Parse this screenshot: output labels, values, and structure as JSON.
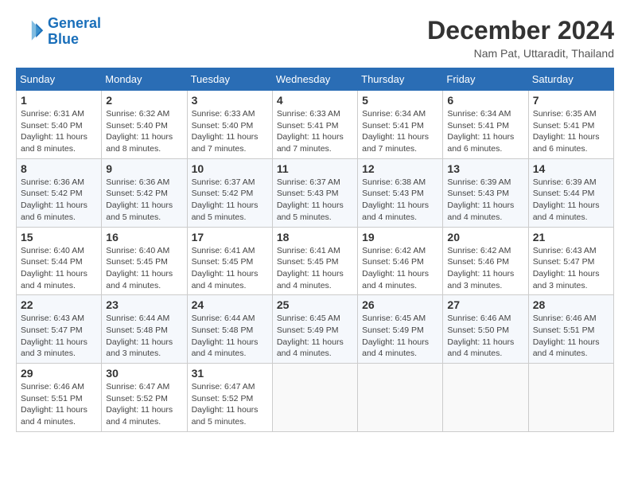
{
  "header": {
    "logo_line1": "General",
    "logo_line2": "Blue",
    "month_title": "December 2024",
    "location": "Nam Pat, Uttaradit, Thailand"
  },
  "days_of_week": [
    "Sunday",
    "Monday",
    "Tuesday",
    "Wednesday",
    "Thursday",
    "Friday",
    "Saturday"
  ],
  "weeks": [
    [
      {
        "day": "1",
        "sunrise": "6:31 AM",
        "sunset": "5:40 PM",
        "daylight": "11 hours and 8 minutes."
      },
      {
        "day": "2",
        "sunrise": "6:32 AM",
        "sunset": "5:40 PM",
        "daylight": "11 hours and 8 minutes."
      },
      {
        "day": "3",
        "sunrise": "6:33 AM",
        "sunset": "5:40 PM",
        "daylight": "11 hours and 7 minutes."
      },
      {
        "day": "4",
        "sunrise": "6:33 AM",
        "sunset": "5:41 PM",
        "daylight": "11 hours and 7 minutes."
      },
      {
        "day": "5",
        "sunrise": "6:34 AM",
        "sunset": "5:41 PM",
        "daylight": "11 hours and 7 minutes."
      },
      {
        "day": "6",
        "sunrise": "6:34 AM",
        "sunset": "5:41 PM",
        "daylight": "11 hours and 6 minutes."
      },
      {
        "day": "7",
        "sunrise": "6:35 AM",
        "sunset": "5:41 PM",
        "daylight": "11 hours and 6 minutes."
      }
    ],
    [
      {
        "day": "8",
        "sunrise": "6:36 AM",
        "sunset": "5:42 PM",
        "daylight": "11 hours and 6 minutes."
      },
      {
        "day": "9",
        "sunrise": "6:36 AM",
        "sunset": "5:42 PM",
        "daylight": "11 hours and 5 minutes."
      },
      {
        "day": "10",
        "sunrise": "6:37 AM",
        "sunset": "5:42 PM",
        "daylight": "11 hours and 5 minutes."
      },
      {
        "day": "11",
        "sunrise": "6:37 AM",
        "sunset": "5:43 PM",
        "daylight": "11 hours and 5 minutes."
      },
      {
        "day": "12",
        "sunrise": "6:38 AM",
        "sunset": "5:43 PM",
        "daylight": "11 hours and 4 minutes."
      },
      {
        "day": "13",
        "sunrise": "6:39 AM",
        "sunset": "5:43 PM",
        "daylight": "11 hours and 4 minutes."
      },
      {
        "day": "14",
        "sunrise": "6:39 AM",
        "sunset": "5:44 PM",
        "daylight": "11 hours and 4 minutes."
      }
    ],
    [
      {
        "day": "15",
        "sunrise": "6:40 AM",
        "sunset": "5:44 PM",
        "daylight": "11 hours and 4 minutes."
      },
      {
        "day": "16",
        "sunrise": "6:40 AM",
        "sunset": "5:45 PM",
        "daylight": "11 hours and 4 minutes."
      },
      {
        "day": "17",
        "sunrise": "6:41 AM",
        "sunset": "5:45 PM",
        "daylight": "11 hours and 4 minutes."
      },
      {
        "day": "18",
        "sunrise": "6:41 AM",
        "sunset": "5:45 PM",
        "daylight": "11 hours and 4 minutes."
      },
      {
        "day": "19",
        "sunrise": "6:42 AM",
        "sunset": "5:46 PM",
        "daylight": "11 hours and 4 minutes."
      },
      {
        "day": "20",
        "sunrise": "6:42 AM",
        "sunset": "5:46 PM",
        "daylight": "11 hours and 3 minutes."
      },
      {
        "day": "21",
        "sunrise": "6:43 AM",
        "sunset": "5:47 PM",
        "daylight": "11 hours and 3 minutes."
      }
    ],
    [
      {
        "day": "22",
        "sunrise": "6:43 AM",
        "sunset": "5:47 PM",
        "daylight": "11 hours and 3 minutes."
      },
      {
        "day": "23",
        "sunrise": "6:44 AM",
        "sunset": "5:48 PM",
        "daylight": "11 hours and 3 minutes."
      },
      {
        "day": "24",
        "sunrise": "6:44 AM",
        "sunset": "5:48 PM",
        "daylight": "11 hours and 4 minutes."
      },
      {
        "day": "25",
        "sunrise": "6:45 AM",
        "sunset": "5:49 PM",
        "daylight": "11 hours and 4 minutes."
      },
      {
        "day": "26",
        "sunrise": "6:45 AM",
        "sunset": "5:49 PM",
        "daylight": "11 hours and 4 minutes."
      },
      {
        "day": "27",
        "sunrise": "6:46 AM",
        "sunset": "5:50 PM",
        "daylight": "11 hours and 4 minutes."
      },
      {
        "day": "28",
        "sunrise": "6:46 AM",
        "sunset": "5:51 PM",
        "daylight": "11 hours and 4 minutes."
      }
    ],
    [
      {
        "day": "29",
        "sunrise": "6:46 AM",
        "sunset": "5:51 PM",
        "daylight": "11 hours and 4 minutes."
      },
      {
        "day": "30",
        "sunrise": "6:47 AM",
        "sunset": "5:52 PM",
        "daylight": "11 hours and 4 minutes."
      },
      {
        "day": "31",
        "sunrise": "6:47 AM",
        "sunset": "5:52 PM",
        "daylight": "11 hours and 5 minutes."
      },
      null,
      null,
      null,
      null
    ]
  ]
}
